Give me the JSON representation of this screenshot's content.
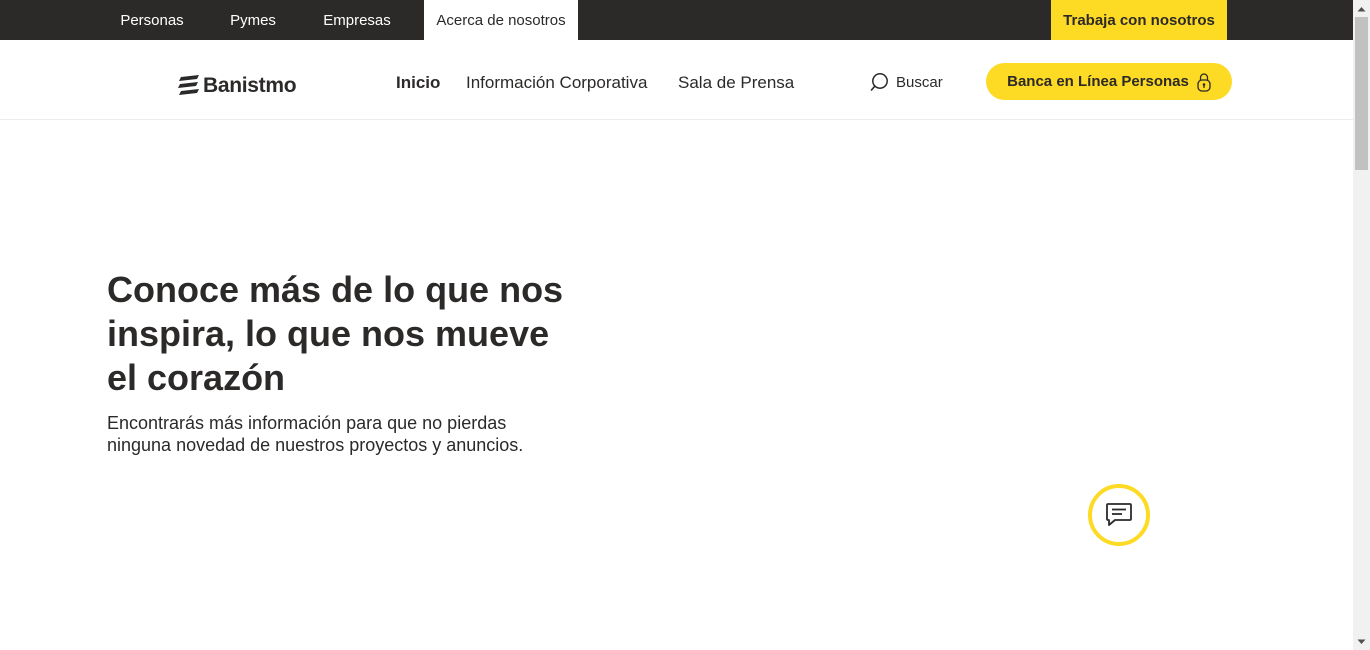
{
  "topbar": {
    "tabs": [
      {
        "label": "Personas",
        "active": false
      },
      {
        "label": "Pymes",
        "active": false
      },
      {
        "label": "Empresas",
        "active": false
      },
      {
        "label": "Acerca de nosotros",
        "active": true
      }
    ],
    "work_label": "Trabaja con nosotros"
  },
  "header": {
    "logo_text": "Banistmo",
    "nav": [
      {
        "label": "Inicio",
        "current": true
      },
      {
        "label": "Información Corporativa",
        "current": false
      },
      {
        "label": "Sala de Prensa",
        "current": false
      }
    ],
    "search_label": "Buscar",
    "online_banking_label": "Banca en Línea Personas"
  },
  "hero": {
    "title_lines": [
      "Conoce más de lo que nos",
      "inspira, lo que nos mueve",
      "el corazón"
    ],
    "subtitle_lines": [
      "Encontrarás más información para que no pierdas",
      "ninguna novedad de nuestros proyectos y anuncios."
    ]
  },
  "icons": {
    "search": "search-icon",
    "lock": "lock-icon",
    "chat": "chat-icon",
    "logo": "banistmo-logo-icon"
  },
  "colors": {
    "brand_yellow": "#fdda24",
    "dark": "#2c2a29",
    "white": "#ffffff"
  }
}
